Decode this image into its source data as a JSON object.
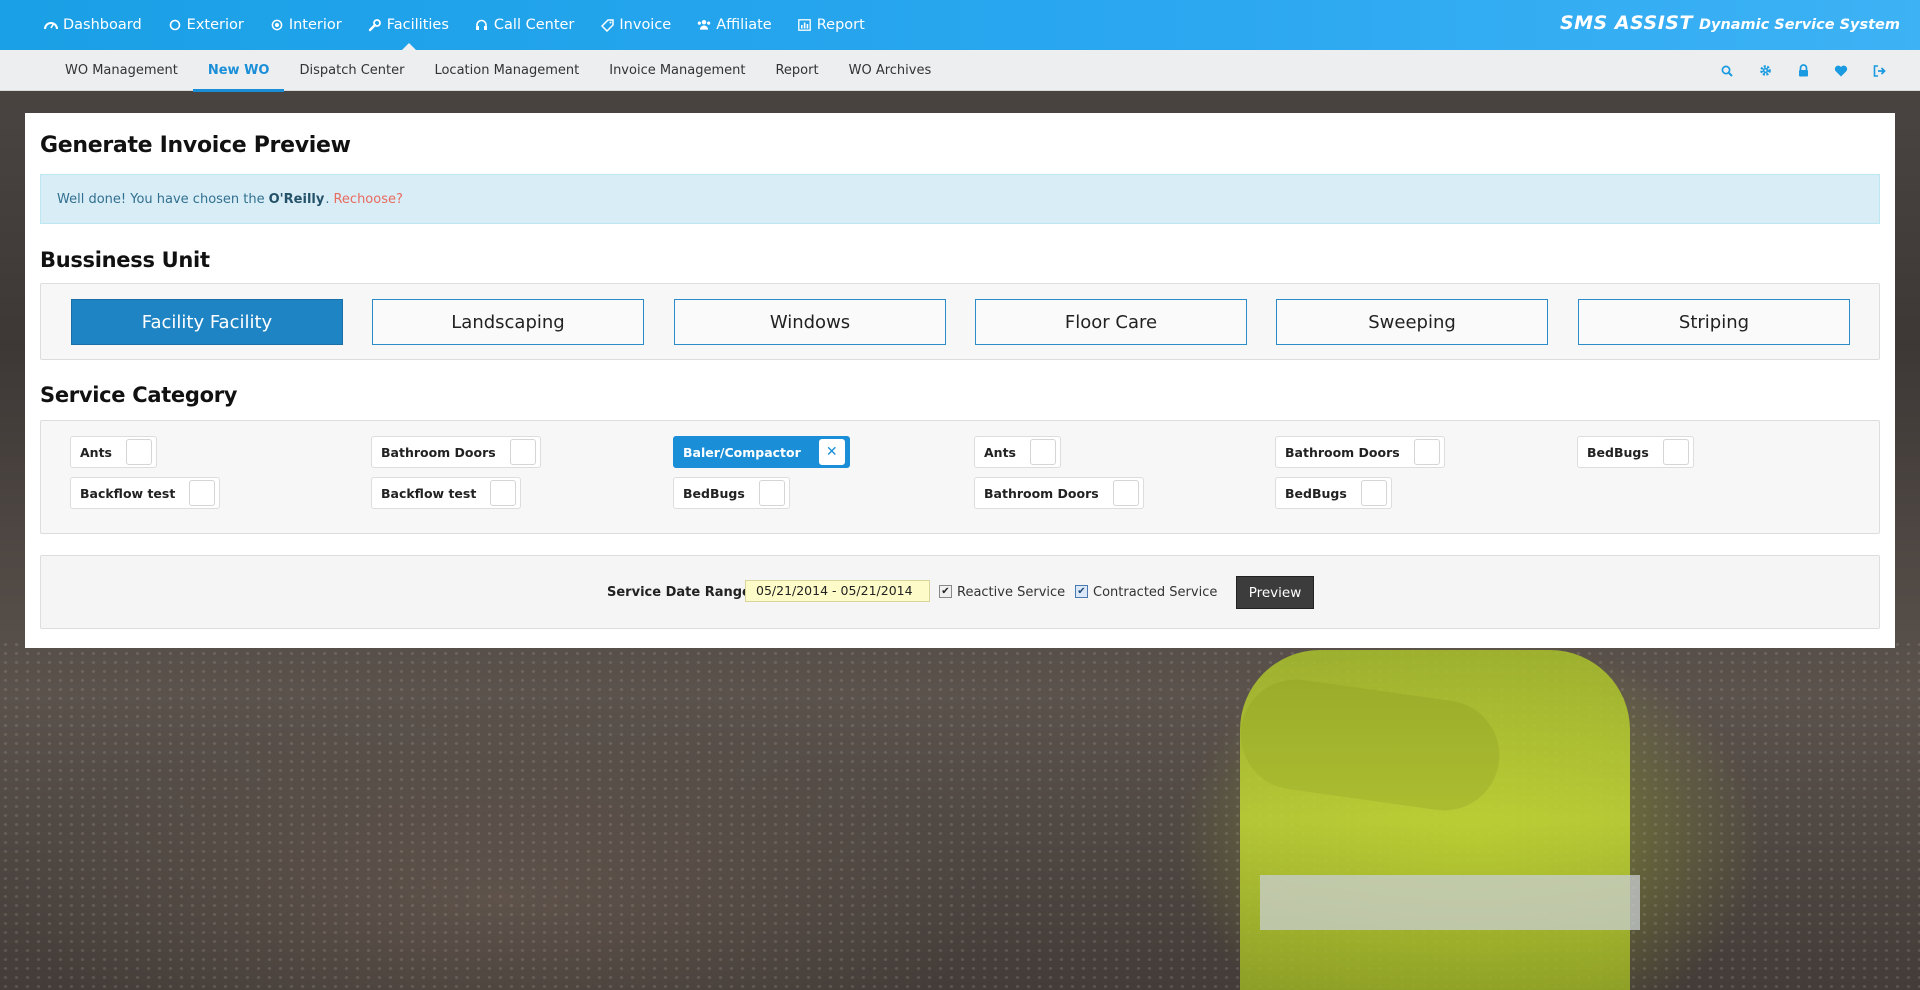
{
  "topnav": {
    "items": [
      {
        "label": "Dashboard",
        "icon": "dashboard-icon"
      },
      {
        "label": "Exterior",
        "icon": "circle-icon"
      },
      {
        "label": "Interior",
        "icon": "target-icon"
      },
      {
        "label": "Facilities",
        "icon": "wrench-icon",
        "active": true
      },
      {
        "label": "Call Center",
        "icon": "headset-icon"
      },
      {
        "label": "Invoice",
        "icon": "tag-icon"
      },
      {
        "label": "Affiliate",
        "icon": "users-icon"
      },
      {
        "label": "Report",
        "icon": "bar-chart-icon"
      }
    ],
    "brand_logo": "SMS ASSIST",
    "brand_tagline": "Dynamic Service System"
  },
  "subnav": {
    "items": [
      {
        "label": "WO Management"
      },
      {
        "label": "New WO",
        "active": true
      },
      {
        "label": "Dispatch Center"
      },
      {
        "label": "Location Management"
      },
      {
        "label": "Invoice Management"
      },
      {
        "label": "Report"
      },
      {
        "label": "WO Archives"
      }
    ],
    "tools": [
      "search-icon",
      "gear-icon",
      "lock-icon",
      "heart-icon",
      "sign-out-icon"
    ]
  },
  "page": {
    "title": "Generate Invoice Preview",
    "alert_prefix": "Well done! You have chosen the",
    "alert_name": "O'Reilly",
    "alert_period": ".",
    "alert_link": "Rechoose?"
  },
  "business_unit": {
    "title": "Bussiness Unit",
    "options": [
      {
        "label": "Facility Facility",
        "selected": true
      },
      {
        "label": "Landscaping"
      },
      {
        "label": "Windows"
      },
      {
        "label": "Floor Care"
      },
      {
        "label": "Sweeping"
      },
      {
        "label": "Striping"
      }
    ]
  },
  "service_category": {
    "title": "Service Category",
    "rows": [
      [
        {
          "label": "Ants"
        },
        {
          "label": "Bathroom Doors"
        },
        {
          "label": "Baler/Compactor",
          "selected": true
        },
        {
          "label": "Ants"
        },
        {
          "label": "Bathroom Doors"
        },
        {
          "label": "BedBugs"
        }
      ],
      [
        {
          "label": "Backflow test"
        },
        {
          "label": "Backflow test"
        },
        {
          "label": "BedBugs"
        },
        {
          "label": "Bathroom Doors"
        },
        {
          "label": "BedBugs"
        }
      ]
    ]
  },
  "filters": {
    "date_label": "Service Date Range",
    "date_value": "05/21/2014 - 05/21/2014",
    "reactive_label": "Reactive Service",
    "reactive_checked": true,
    "contracted_label": "Contracted Service",
    "contracted_checked": true,
    "preview_label": "Preview"
  },
  "colors": {
    "topnav": "#2aa7f0",
    "accent": "#1a8fd8",
    "selected_button": "#1f84c4",
    "alert_bg": "#d9edf7",
    "rechoose": "#e86b5f"
  }
}
